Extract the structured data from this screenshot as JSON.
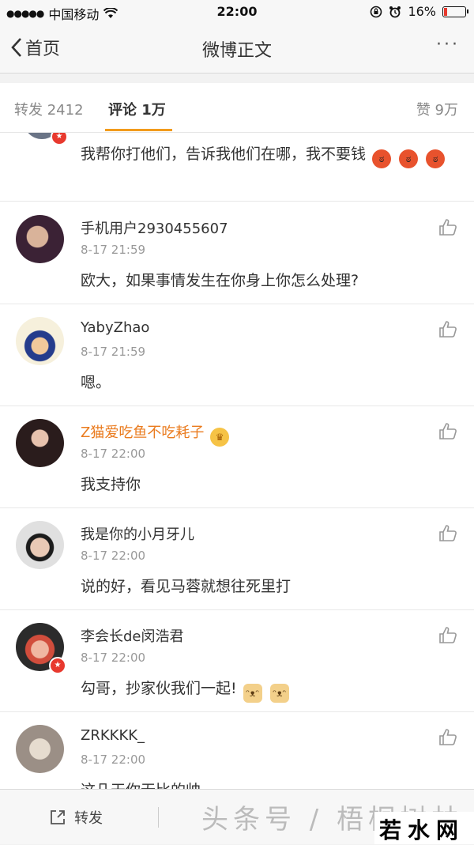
{
  "status_bar": {
    "signal": "●●●●●",
    "carrier": "中国移动",
    "time": "22:00",
    "battery_percent": "16%",
    "battery_level": 0.16
  },
  "nav": {
    "back_label": "首页",
    "title": "微博正文",
    "more": "···"
  },
  "tabs": {
    "repost": "转发 2412",
    "comments": "评论 1万",
    "likes": "赞 9万"
  },
  "first_comment": {
    "text": "我帮你打他们，告诉我他们在哪，我不要钱"
  },
  "comments": [
    {
      "name": "手机用户2930455607",
      "time": "8-17 21:59",
      "text": "欧大，如果事情发生在你身上你怎么处理?"
    },
    {
      "name": "YabyZhao",
      "time": "8-17 21:59",
      "text": "嗯。"
    },
    {
      "name": "Z猫爱吃鱼不吃耗子",
      "time": "8-17 22:00",
      "text": "我支持你"
    },
    {
      "name": "我是你的小月牙儿",
      "time": "8-17 22:00",
      "text": "说的好，看见马蓉就想往死里打"
    },
    {
      "name": "李会长de闵浩君",
      "time": "8-17 22:00",
      "text": "勾哥，抄家伙我们一起!"
    },
    {
      "name": "ZRKKKK_",
      "time": "8-17 22:00",
      "text": "这几天你无比的帅"
    }
  ],
  "bottom": {
    "repost_label": "转发",
    "watermark": "头条号 / 梧桐树林",
    "logo": "若水网"
  },
  "colors": {
    "accent_orange": "#f29b1c",
    "vip_name": "#ea7b1e",
    "badge_red": "#e8392e"
  }
}
